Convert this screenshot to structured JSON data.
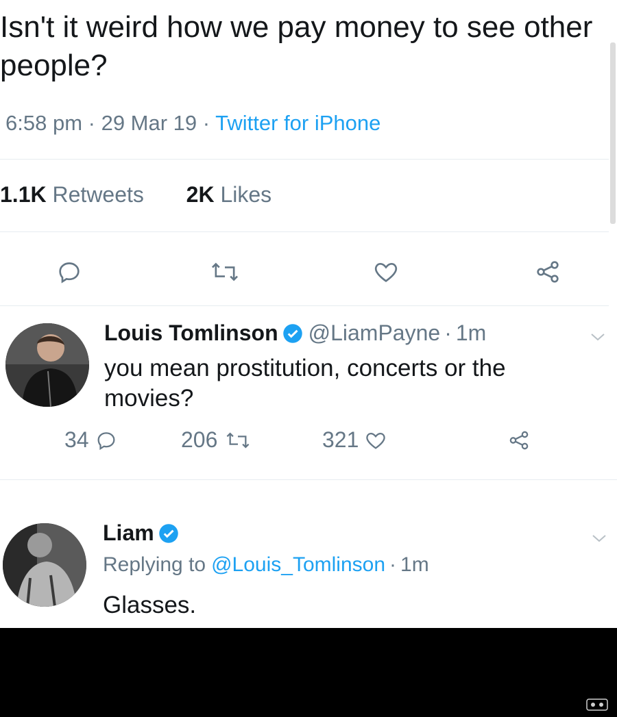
{
  "tweet": {
    "text": "Isn't it weird how we pay money to see other people?",
    "time": "6:58 pm",
    "date": "29 Mar 19",
    "source": "Twitter for iPhone",
    "retweets_count": "1.1K",
    "retweets_label": "Retweets",
    "likes_count": "2K",
    "likes_label": "Likes"
  },
  "reply1": {
    "name": "Louis Tomlinson",
    "handle": "@LiamPayne",
    "time": "1m",
    "text": "you mean prostitution, concerts or the movies?",
    "reply_count": "34",
    "retweet_count": "206",
    "like_count": "321"
  },
  "reply2": {
    "name": "Liam",
    "replying_to_label": "Replying to",
    "replying_to_handle": "@Louis_Tomlinson",
    "time": "1m",
    "text": "Glasses."
  },
  "colors": {
    "link_blue": "#1da1f2",
    "secondary_text": "#657786",
    "verified_blue": "#1da1f2"
  },
  "icons": [
    "reply-icon",
    "retweet-icon",
    "like-icon",
    "share-icon",
    "verified-icon",
    "chevron-down-icon"
  ]
}
